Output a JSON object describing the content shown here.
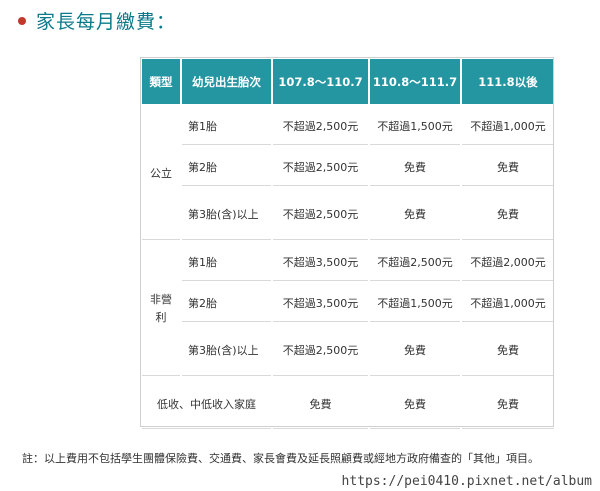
{
  "heading": "家長每月繳費：",
  "table": {
    "headers": [
      "類型",
      "幼兒出生胎次",
      "107.8～110.7",
      "110.8～111.7",
      "111.8以後"
    ],
    "groups": [
      {
        "category": "公立",
        "rows": [
          {
            "birth": "第1胎",
            "c1": "不超過2,500元",
            "c2": "不超過1,500元",
            "c3": "不超過1,000元"
          },
          {
            "birth": "第2胎",
            "c1": "不超過2,500元",
            "c2": "免費",
            "c3": "免費"
          },
          {
            "birth": "第3胎(含)以上",
            "c1": "不超過2,500元",
            "c2": "免費",
            "c3": "免費"
          }
        ]
      },
      {
        "category": "非營利",
        "rows": [
          {
            "birth": "第1胎",
            "c1": "不超過3,500元",
            "c2": "不超過2,500元",
            "c3": "不超過2,000元"
          },
          {
            "birth": "第2胎",
            "c1": "不超過3,500元",
            "c2": "不超過1,500元",
            "c3": "不超過1,000元"
          },
          {
            "birth": "第3胎(含)以上",
            "c1": "不超過2,500元",
            "c2": "免費",
            "c3": "免費"
          }
        ]
      }
    ],
    "low_income": {
      "label": "低收、中低收入家庭",
      "c1": "免費",
      "c2": "免費",
      "c3": "免費"
    }
  },
  "note": "註：以上費用不包括學生團體保險費、交通費、家長會費及延長照顧費或經地方政府備查的「其他」項目。",
  "watermark": "https://pei0410.pixnet.net/album"
}
